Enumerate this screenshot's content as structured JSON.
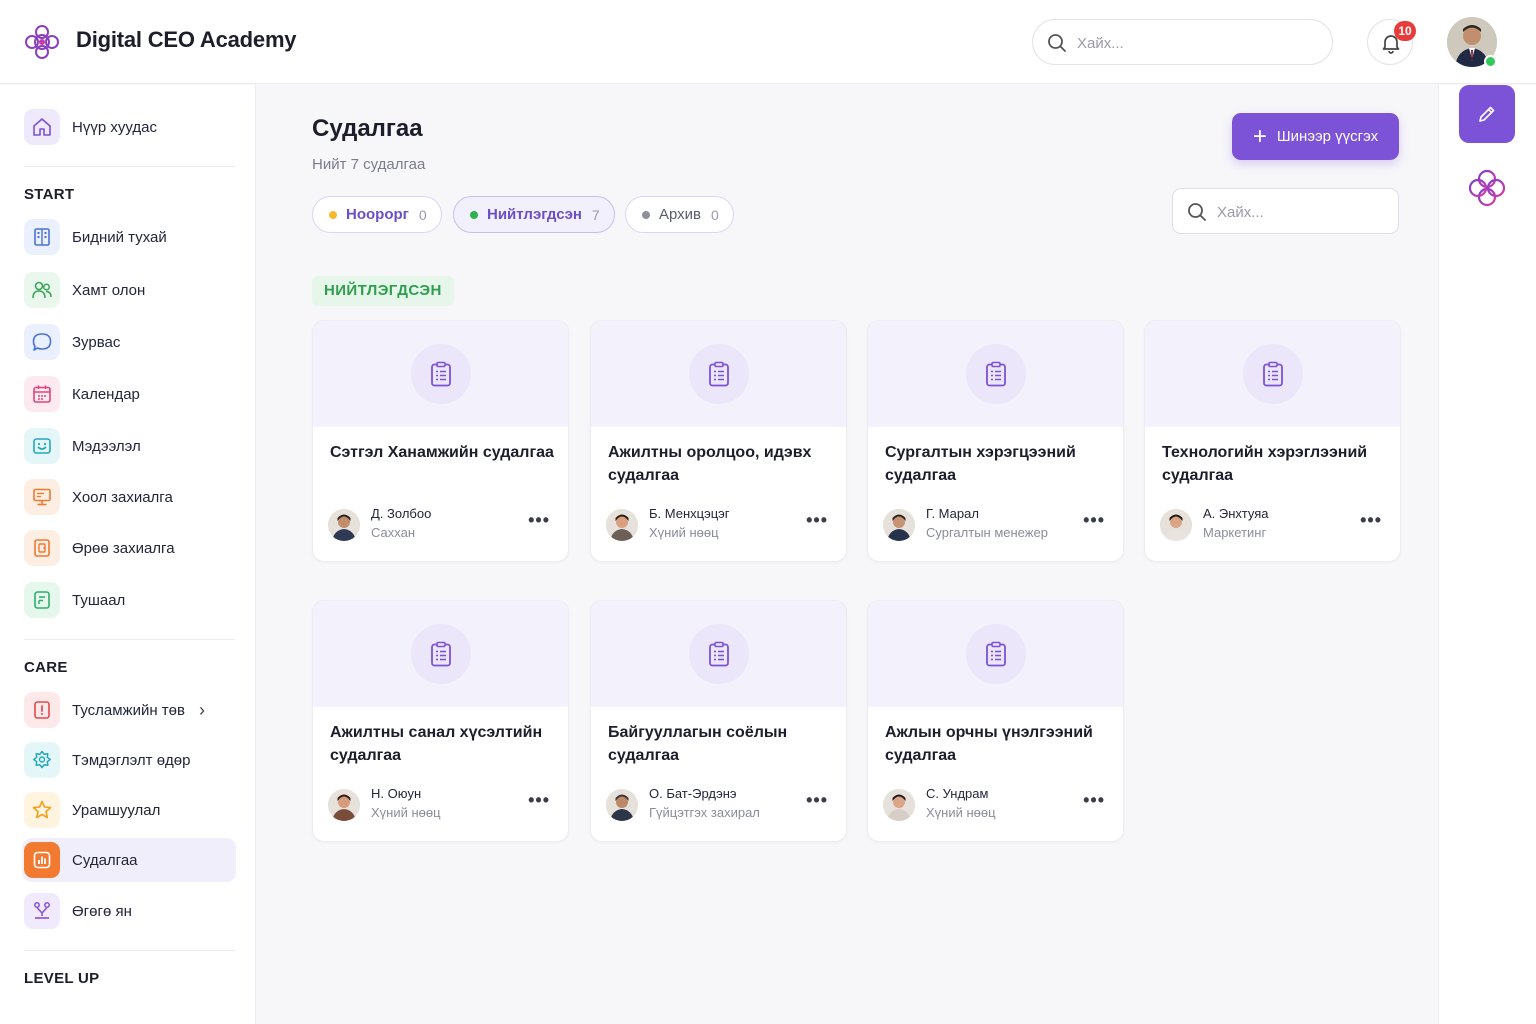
{
  "header": {
    "app_title": "Digital CEO Academy",
    "search_placeholder": "Хайх...",
    "notification_count": "10"
  },
  "sidebar": {
    "home": "Нүүр хуудас",
    "sections": [
      {
        "title": "START",
        "items": [
          "Бидний тухай",
          "Хамт олон",
          "Зурвас",
          "Календар",
          "Мэдээлэл",
          "Хоол захиалга",
          "Өрөө захиалга",
          "Тушаал"
        ]
      },
      {
        "title": "CARE",
        "items": [
          "Тусламжийн төв",
          "Тэмдэглэлт өдөр",
          "Урамшуулал",
          "Судалгаа",
          "Өгөгө ян"
        ]
      },
      {
        "title": "LEVEL UP",
        "items": []
      }
    ],
    "active_item": "Судалгаа"
  },
  "main": {
    "title": "Судалгаа",
    "subtitle": "Нийт 7 судалгаа",
    "add_button": "Шинээр үүсгэх",
    "search_placeholder": "Хайх...",
    "filters": [
      {
        "label": "Ноорорг",
        "count": "0",
        "dot_color": "#f5b82e"
      },
      {
        "label": "Нийтлэгдсэн",
        "count": "7",
        "dot_color": "#2fb14f"
      },
      {
        "label": "Архив",
        "count": "0",
        "dot_color": "#8e8f9c"
      }
    ],
    "section_label": "НИЙТЛЭГДСЭН",
    "cards": [
      {
        "title": "Сэтгэл Ханамжийн судалгаа",
        "author": "Д. Золбоо",
        "role": "Саххан"
      },
      {
        "title": "Ажилтны оролцоо, идэвх судалгаа",
        "author": "Б. Менхцэцэг",
        "role": "Хүний нөөц"
      },
      {
        "title": "Сургалтын хэрэгцээний судалгаа",
        "author": "Г. Марал",
        "role": "Сургалтын менежер"
      },
      {
        "title": "Технологийн хэрэглээний судалгаа",
        "author": "А. Энхтуяа",
        "role": "Маркетинг"
      },
      {
        "title": "Ажилтны санал хүсэлтийн судалгаа",
        "author": "Н. Оюун",
        "role": "Хүний нөөц"
      },
      {
        "title": "Байгууллагын соёлын судалгаа",
        "author": "О. Бат-Эрдэнэ",
        "role": "Гүйцэтгэх захирал"
      },
      {
        "title": "Ажлын орчны үнэлгээний судалгаа",
        "author": "С. Ундрам",
        "role": "Хүний нөөц"
      }
    ]
  },
  "colors": {
    "accent": "#7c52d6",
    "published_green": "#2f9e4f",
    "badge_red": "#ea3b3b"
  }
}
